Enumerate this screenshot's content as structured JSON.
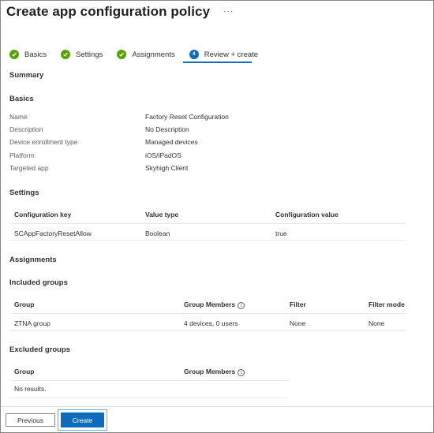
{
  "header": {
    "title": "Create app configuration policy",
    "more": "···"
  },
  "tabs": [
    {
      "label": "Basics",
      "state": "done"
    },
    {
      "label": "Settings",
      "state": "done"
    },
    {
      "label": "Assignments",
      "state": "done"
    },
    {
      "label": "Review + create",
      "state": "active",
      "step": "4"
    }
  ],
  "summary": {
    "title": "Summary"
  },
  "basics": {
    "title": "Basics",
    "rows": [
      {
        "label": "Name",
        "value": "Factory Reset Configuration"
      },
      {
        "label": "Description",
        "value": "No Description"
      },
      {
        "label": "Device enrollment type",
        "value": "Managed devices"
      },
      {
        "label": "Platform",
        "value": "iOS/iPadOS"
      },
      {
        "label": "Targeted app",
        "value": "Skyhigh Client"
      }
    ]
  },
  "settings": {
    "title": "Settings",
    "columns": [
      "Configuration key",
      "Value type",
      "Configuration value"
    ],
    "rows": [
      [
        "SCAppFactoryResetAllow",
        "Boolean",
        "true"
      ]
    ]
  },
  "assignments": {
    "title": "Assignments"
  },
  "included": {
    "title": "Included groups",
    "columns": [
      "Group",
      "Group Members",
      "Filter",
      "Filter mode"
    ],
    "rows": [
      [
        "ZTNA group",
        "4 devices, 0 users",
        "None",
        "None"
      ]
    ]
  },
  "excluded": {
    "title": "Excluded groups",
    "columns": [
      "Group",
      "Group Members"
    ],
    "empty_text": "No results."
  },
  "footer": {
    "previous_label": "Previous",
    "create_label": "Create"
  },
  "colors": {
    "accent": "#0f6cbd",
    "success": "#57a300"
  }
}
